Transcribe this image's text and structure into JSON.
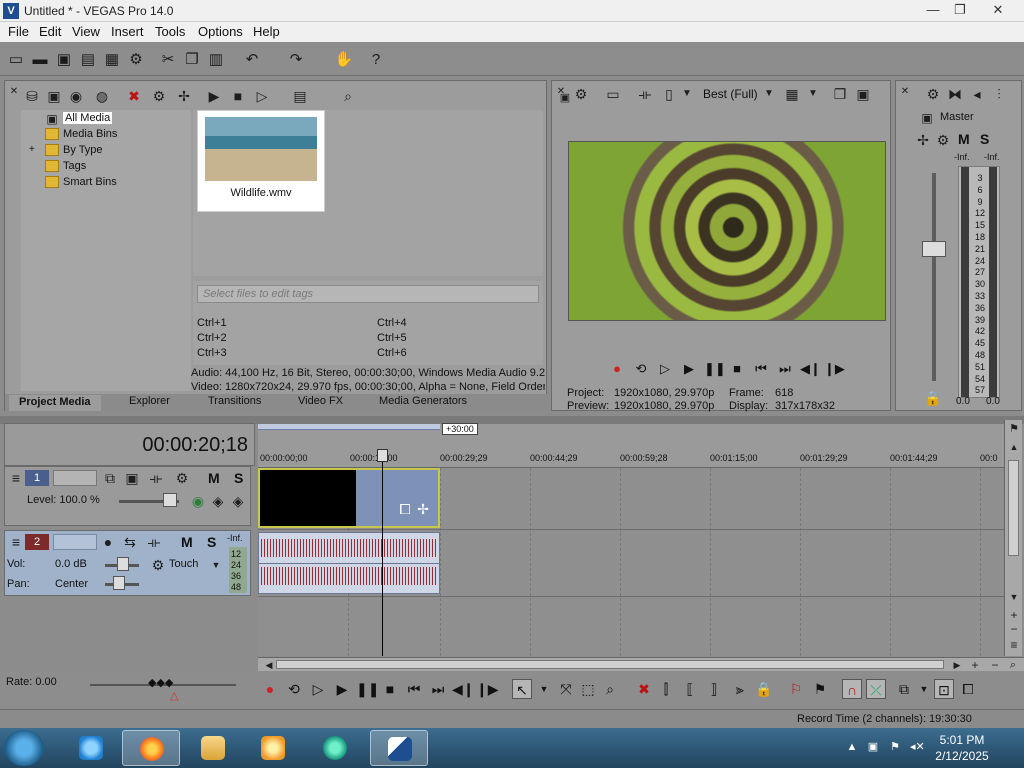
{
  "window": {
    "title": "Untitled * - VEGAS Pro 14.0",
    "app_icon": "vegas-logo-icon",
    "minimize": "—",
    "maximize": "❐",
    "close": "✕"
  },
  "menu": [
    "File",
    "Edit",
    "View",
    "Insert",
    "Tools",
    "Options",
    "Help"
  ],
  "toolbar": {
    "icons": [
      "new-icon",
      "open-icon",
      "save-icon",
      "save-as-icon",
      "properties-icon",
      "cut-icon",
      "copy-icon",
      "paste-icon",
      "undo-icon",
      "redo-icon",
      "render-icon",
      "help-icon"
    ]
  },
  "project_media": {
    "tree": [
      "All Media",
      "Media Bins",
      "By Type",
      "Tags",
      "Smart Bins"
    ],
    "expander": "+",
    "file_name": "Wildlife.wmv",
    "tag_placeholder": "Select files to edit tags",
    "shortcuts": [
      "Ctrl+1",
      "Ctrl+2",
      "Ctrl+3",
      "Ctrl+4",
      "Ctrl+5",
      "Ctrl+6"
    ],
    "audio_info": "Audio: 44,100 Hz, 16 Bit, Stereo, 00:00:30;00, Windows Media Audio 9.2",
    "video_info": "Video: 1280x720x24, 29.970 fps, 00:00:30;00, Alpha = None, Field Order",
    "tabs": [
      "Project Media",
      "Explorer",
      "Transitions",
      "Video FX",
      "Media Generators"
    ]
  },
  "preview": {
    "quality": "Best (Full)",
    "project_label": "Project:",
    "project_value": "1920x1080, 29.970p",
    "preview_label": "Preview:",
    "preview_value": "1920x1080, 29.970p",
    "frame_label": "Frame:",
    "frame_value": "618",
    "display_label": "Display:",
    "display_value": "317x178x32"
  },
  "master": {
    "label": "Master",
    "m": "M",
    "s": "S",
    "inf_left": "-Inf.",
    "inf_right": "-Inf.",
    "scale": [
      "3",
      "6",
      "9",
      "12",
      "15",
      "18",
      "21",
      "24",
      "27",
      "30",
      "33",
      "36",
      "39",
      "42",
      "45",
      "48",
      "51",
      "54",
      "57"
    ],
    "left_value": "0.0",
    "right_value": "0.0"
  },
  "timeline": {
    "time": "00:00:20;18",
    "loop_tag": "+30:00",
    "ticks": [
      "00:00:00;00",
      "00:00:15;00",
      "00:00:29;29",
      "00:00:44;29",
      "00:00:59;28",
      "00:01:15;00",
      "00:01:29;29",
      "00:01:44;29",
      "00:0"
    ],
    "track1": {
      "num": "1",
      "m": "M",
      "s": "S",
      "level": "Level: 100.0 %"
    },
    "track2": {
      "num": "2",
      "m": "M",
      "s": "S",
      "vol_label": "Vol:",
      "vol_value": "0.0 dB",
      "pan_label": "Pan:",
      "pan_value": "Center",
      "mode": "Touch",
      "meter": [
        "-Inf.",
        "12",
        "24",
        "36",
        "48"
      ]
    },
    "rate": "Rate: 0.00"
  },
  "status": {
    "record_time": "Record Time (2 channels): 19:30:30"
  },
  "taskbar": {
    "time": "5:01 PM",
    "date": "2/12/2025"
  }
}
